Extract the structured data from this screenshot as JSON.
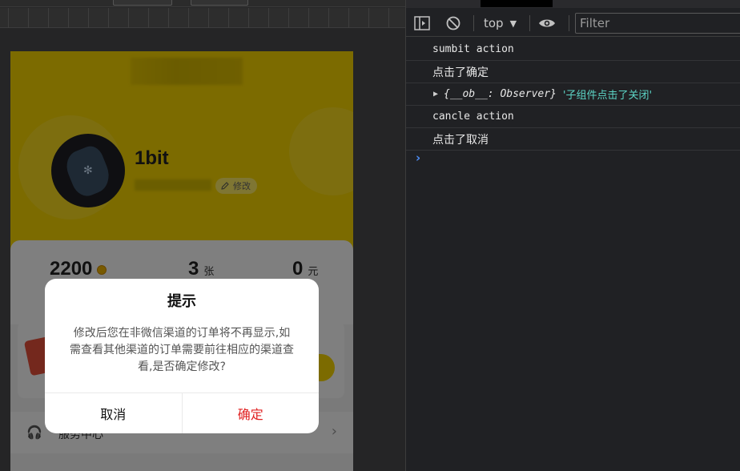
{
  "phone": {
    "username": "1bit",
    "edit_label": "修改",
    "stats": [
      {
        "value": "2200",
        "unit": ""
      },
      {
        "value": "3",
        "unit": "张"
      },
      {
        "value": "0",
        "unit": "元"
      }
    ],
    "service_label": "服务中心"
  },
  "dialog": {
    "title": "提示",
    "message": "修改后您在非微信渠道的订单将不再显示,如需查看其他渠道的订单需要前往相应的渠道查看,是否确定修改?",
    "cancel_label": "取消",
    "confirm_label": "确定",
    "confirm_color": "#e02020"
  },
  "devtools": {
    "context_label": "top",
    "filter_placeholder": "Filter",
    "logs": [
      {
        "text": "sumbit action"
      },
      {
        "text": "点击了确定"
      },
      {
        "object": "{__ob__: Observer}",
        "string": "'子组件点击了关闭'"
      },
      {
        "text": "cancle action"
      },
      {
        "text": "点击了取消"
      }
    ],
    "prompt_symbol": "›",
    "accent_color": "#4d8df5"
  }
}
